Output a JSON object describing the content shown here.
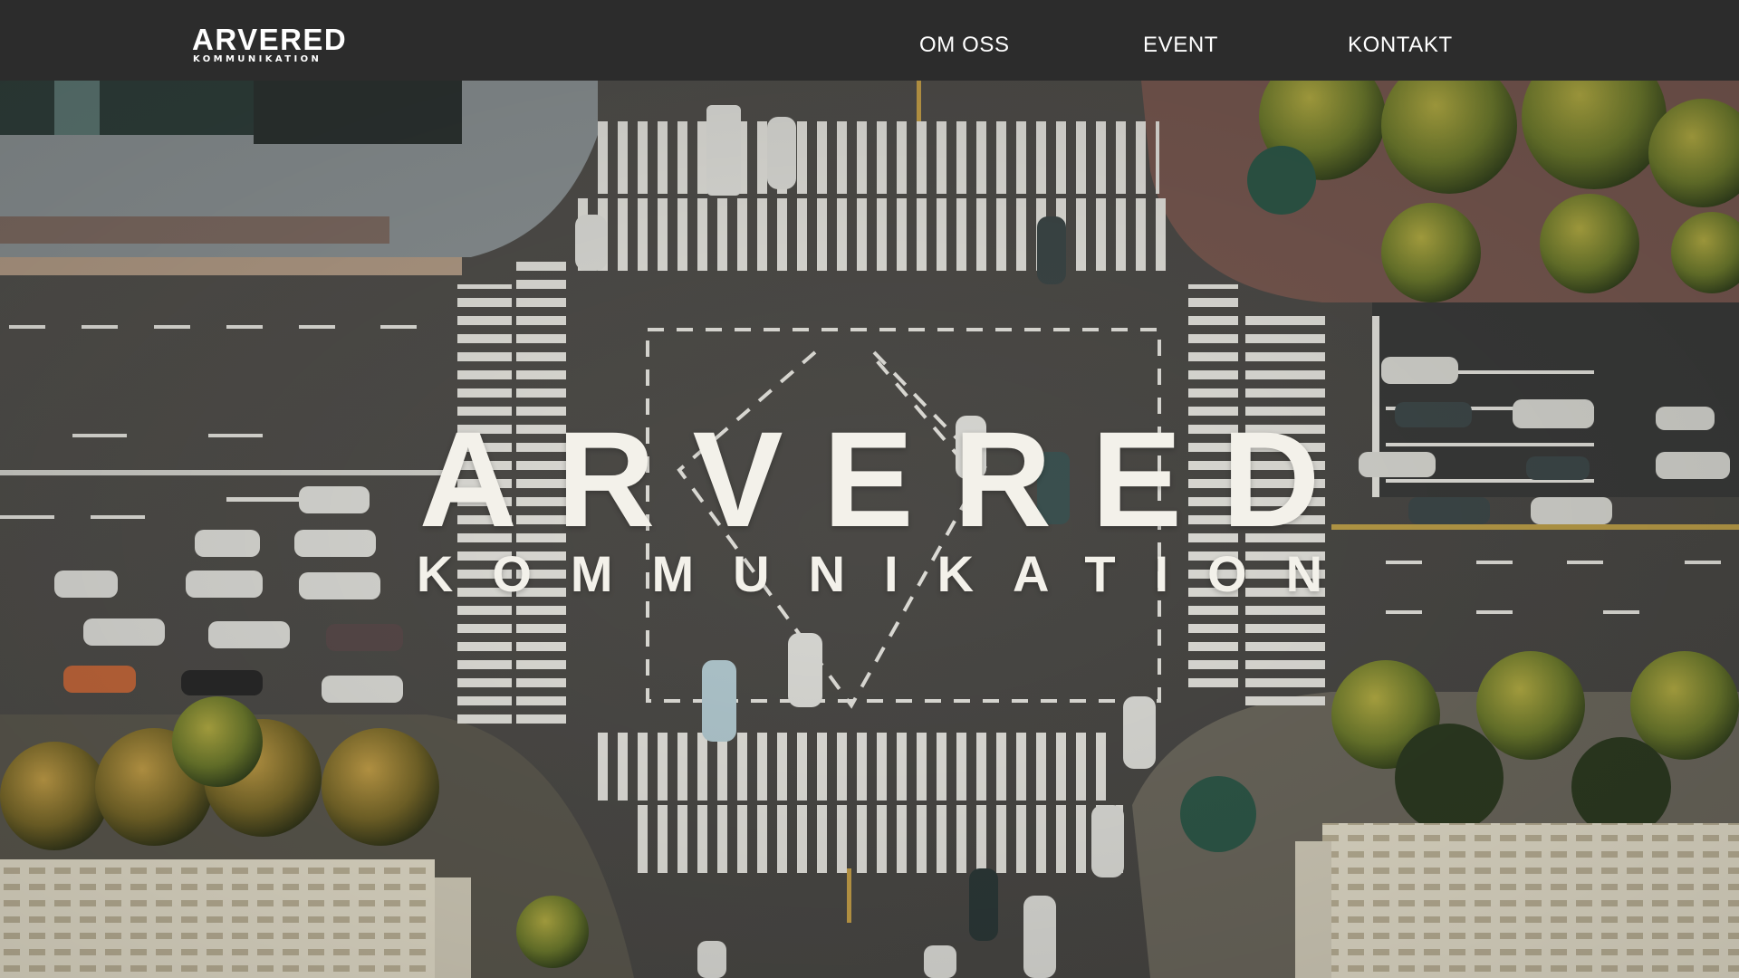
{
  "header": {
    "logo_main": "ARVERED",
    "logo_sub": "KOMMUNIKATION",
    "nav": [
      {
        "label": "OM OSS"
      },
      {
        "label": "EVENT"
      },
      {
        "label": "KONTAKT"
      }
    ],
    "background_color": "#2c2c2c"
  },
  "hero": {
    "title": "ARVERED",
    "subtitle": "KOMMUNIKATION",
    "text_color": "#f3f1ea",
    "background_image": "aerial-city-intersection"
  }
}
